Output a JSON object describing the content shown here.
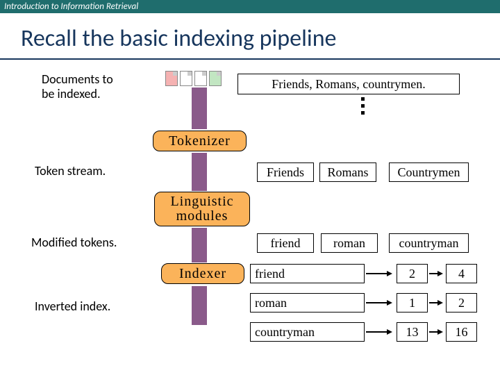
{
  "header": {
    "course": "Introduction to Information Retrieval"
  },
  "title": "Recall the basic indexing pipeline",
  "labels": {
    "documents": "Documents to\nbe indexed.",
    "token_stream": "Token stream.",
    "modified_tokens": "Modified tokens.",
    "inverted_index": "Inverted index."
  },
  "input_text": "Friends, Romans, countrymen.",
  "stages": {
    "tokenizer": "Tokenizer",
    "linguistic": "Linguistic\nmodules",
    "indexer": "Indexer"
  },
  "tokens_raw": [
    "Friends",
    "Romans",
    "Countrymen"
  ],
  "tokens_mod": [
    "friend",
    "roman",
    "countryman"
  ],
  "index": [
    {
      "term": "friend",
      "postings": [
        "2",
        "4"
      ]
    },
    {
      "term": "roman",
      "postings": [
        "1",
        "2"
      ]
    },
    {
      "term": "countryman",
      "postings": [
        "13",
        "16"
      ]
    }
  ]
}
